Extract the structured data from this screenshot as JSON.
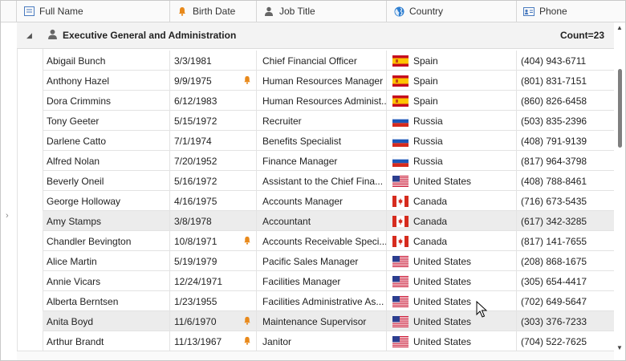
{
  "columns": [
    {
      "label": "Full Name",
      "icon": "checkbox-list-icon"
    },
    {
      "label": "Birth Date",
      "icon": "bell-icon"
    },
    {
      "label": "Job Title",
      "icon": "person-icon"
    },
    {
      "label": "Country",
      "icon": "globe-icon"
    },
    {
      "label": "Phone",
      "icon": "contact-card-icon"
    }
  ],
  "group": {
    "title": "Executive General and Administration",
    "count": "Count=23"
  },
  "rows": [
    {
      "name": "Abigail Bunch",
      "date": "3/3/1981",
      "bell": false,
      "job": "Chief Financial Officer",
      "country": "Spain",
      "phone": "(404) 943-6711"
    },
    {
      "name": "Anthony Hazel",
      "date": "9/9/1975",
      "bell": true,
      "job": "Human Resources Manager",
      "country": "Spain",
      "phone": "(801) 831-7151"
    },
    {
      "name": "Dora Crimmins",
      "date": "6/12/1983",
      "bell": false,
      "job": "Human Resources Administ...",
      "country": "Spain",
      "phone": "(860) 826-6458"
    },
    {
      "name": "Tony Geeter",
      "date": "5/15/1972",
      "bell": false,
      "job": "Recruiter",
      "country": "Russia",
      "phone": "(503) 835-2396"
    },
    {
      "name": "Darlene Catto",
      "date": "7/1/1974",
      "bell": false,
      "job": "Benefits Specialist",
      "country": "Russia",
      "phone": "(408) 791-9139"
    },
    {
      "name": "Alfred Nolan",
      "date": "7/20/1952",
      "bell": false,
      "job": "Finance Manager",
      "country": "Russia",
      "phone": "(817) 964-3798"
    },
    {
      "name": "Beverly Oneil",
      "date": "5/16/1972",
      "bell": false,
      "job": "Assistant to the Chief Fina...",
      "country": "United States",
      "phone": "(408) 788-8461"
    },
    {
      "name": "George Holloway",
      "date": "4/16/1975",
      "bell": false,
      "job": "Accounts Manager",
      "country": "Canada",
      "phone": "(716) 673-5435"
    },
    {
      "name": "Amy Stamps",
      "date": "3/8/1978",
      "bell": false,
      "job": "Accountant",
      "country": "Canada",
      "phone": "(617) 342-3285"
    },
    {
      "name": "Chandler Bevington",
      "date": "10/8/1971",
      "bell": true,
      "job": "Accounts Receivable Speci...",
      "country": "Canada",
      "phone": "(817) 141-7655"
    },
    {
      "name": "Alice Martin",
      "date": "5/19/1979",
      "bell": false,
      "job": "Pacific Sales Manager",
      "country": "United States",
      "phone": "(208) 868-1675"
    },
    {
      "name": "Annie Vicars",
      "date": "12/24/1971",
      "bell": false,
      "job": "Facilities Manager",
      "country": "United States",
      "phone": "(305) 654-4417"
    },
    {
      "name": "Alberta Berntsen",
      "date": "1/23/1955",
      "bell": false,
      "job": "Facilities Administrative As...",
      "country": "United States",
      "phone": "(702) 649-5647"
    },
    {
      "name": "Anita Boyd",
      "date": "11/6/1970",
      "bell": true,
      "job": "Maintenance Supervisor",
      "country": "United States",
      "phone": "(303) 376-7233"
    },
    {
      "name": "Arthur Brandt",
      "date": "11/13/1967",
      "bell": true,
      "job": "Janitor",
      "country": "United States",
      "phone": "(704) 522-7625"
    }
  ],
  "selected_rows": [
    "Amy Stamps",
    "Anita Boyd"
  ],
  "colors": {
    "accent_bell": "#e8891b",
    "header_bg": "#fafafa",
    "selected_bg": "#ececec"
  }
}
